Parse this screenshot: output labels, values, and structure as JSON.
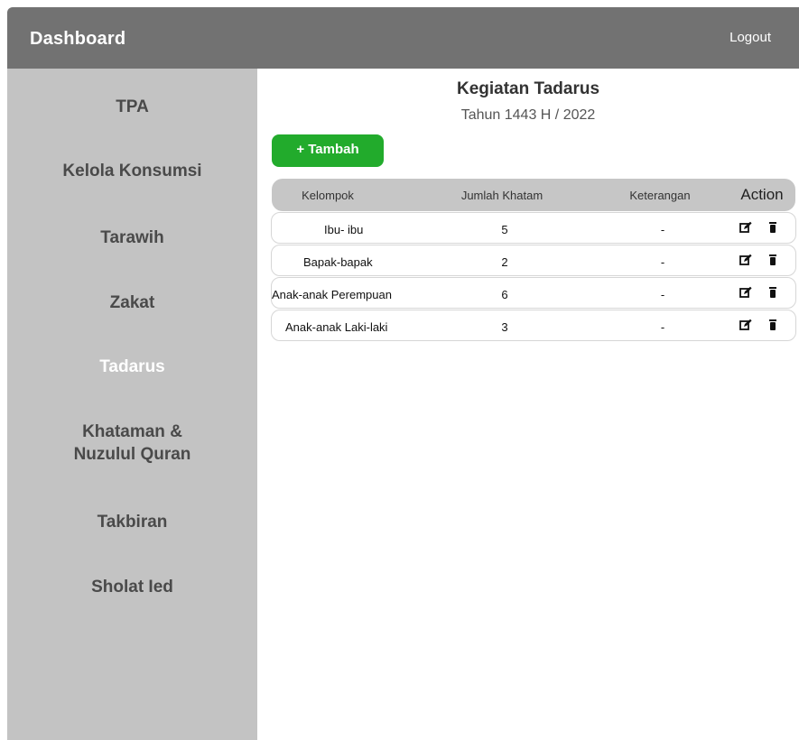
{
  "header": {
    "title": "Dashboard",
    "logout_label": "Logout"
  },
  "sidebar": {
    "items": [
      {
        "label": "TPA"
      },
      {
        "label": "Kelola Konsumsi"
      },
      {
        "label": "Tarawih"
      },
      {
        "label": "Zakat"
      },
      {
        "label": "Tadarus",
        "active": true
      },
      {
        "label": "Khataman &",
        "label2": "Nuzulul Quran"
      },
      {
        "label": "Takbiran"
      },
      {
        "label": "Sholat Ied"
      }
    ]
  },
  "main": {
    "title": "Kegiatan Tadarus",
    "subtitle": "Tahun 1443 H / 2022",
    "add_label": "+ Tambah"
  },
  "table": {
    "columns": [
      "Kelompok",
      "Jumlah Khatam",
      "Keterangan",
      "Action"
    ],
    "rows": [
      {
        "kelompok": "Ibu- ibu",
        "jumlah": "5",
        "keterangan": "-"
      },
      {
        "kelompok": "Bapak-bapak",
        "jumlah": "2",
        "keterangan": "-"
      },
      {
        "kelompok": "Anak-anak Perempuan",
        "jumlah": "6",
        "keterangan": "-"
      },
      {
        "kelompok": "Anak-anak Laki-laki",
        "jumlah": "3",
        "keterangan": "-"
      }
    ],
    "icons": {
      "edit": "edit-icon",
      "delete": "trash-icon"
    }
  },
  "colors": {
    "topbar": "#727272",
    "sidebar": "#c3c3c3",
    "accent_green": "#22ab2c",
    "table_header": "#c6c6c6"
  }
}
